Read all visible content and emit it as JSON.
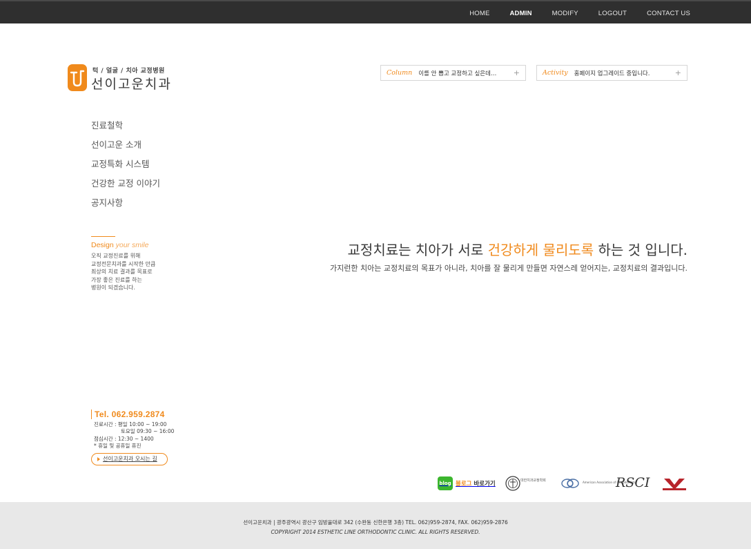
{
  "topnav": [
    "HOME",
    "ADMIN",
    "MODIFY",
    "LOGOUT",
    "CONTACT US"
  ],
  "logo": {
    "tagline": "턱 / 얼굴 / 치아 교정병원",
    "name": "선이고운치과"
  },
  "tickers": {
    "column": {
      "label": "Column",
      "text": "이를 안 뽑고 교정하고 싶은데…"
    },
    "activity": {
      "label": "Activity",
      "text": "홈페이지 업그레이드 중입니다."
    }
  },
  "sidemenu": [
    "진료철학",
    "선이고운 소개",
    "교정특화 시스템",
    "건강한 교정 이야기",
    "공지사항"
  ],
  "design": {
    "title_a": "Design",
    "title_b": "your smile",
    "lines": [
      "오직 교정진료를 위해",
      "교정전문치과를 시작한 만큼",
      "최상의 치료 결과를 목표로",
      "가장 좋은 진료를 하는",
      "병원이 되겠습니다."
    ]
  },
  "headline": {
    "before": "교정치료는 치아가 서로 ",
    "highlight": "건강하게 물리도록",
    "after": " 하는 것 입니다.",
    "sub": "가지런한 치아는 교정치료의 목표가 아니라, 치아를 잘 물리게 만들면 자연스레 얻어지는, 교정치료의 결과입니다."
  },
  "contact": {
    "tel": "Tel. 062.959.2874",
    "hours1": "진료시간 : 평일 10:00 ~ 19:00",
    "hours2": "토요일  09:30 ~ 16:00",
    "lunch": "점심시간 : 12:30 ~ 1400",
    "closed": "* 휴일 및 공휴일 휴진",
    "route": "선이고운치과 오시는 길"
  },
  "partners": {
    "blog_icon": "blog",
    "blog_a": "블로그",
    "blog_b": " 바로가기",
    "kao": "대한치과교정학회",
    "aao": "American Association of Orthodontists",
    "rsc": "RSCI"
  },
  "footer": {
    "address": "선이고운치과 | 광주광역시 광산구 임방울대로 342 (수완동 신한은행 3층) TEL. 062)959-2874, FAX. 062)959-2876",
    "copyright": "COPYRIGHT 2014 ESTHETIC LINE ORTHODONTIC CLINIC. ALL RIGHTS RESERVED."
  },
  "colors": {
    "accent": "#f08a1c",
    "topbar": "#2f2f2f",
    "footer": "#e8e8e8"
  }
}
